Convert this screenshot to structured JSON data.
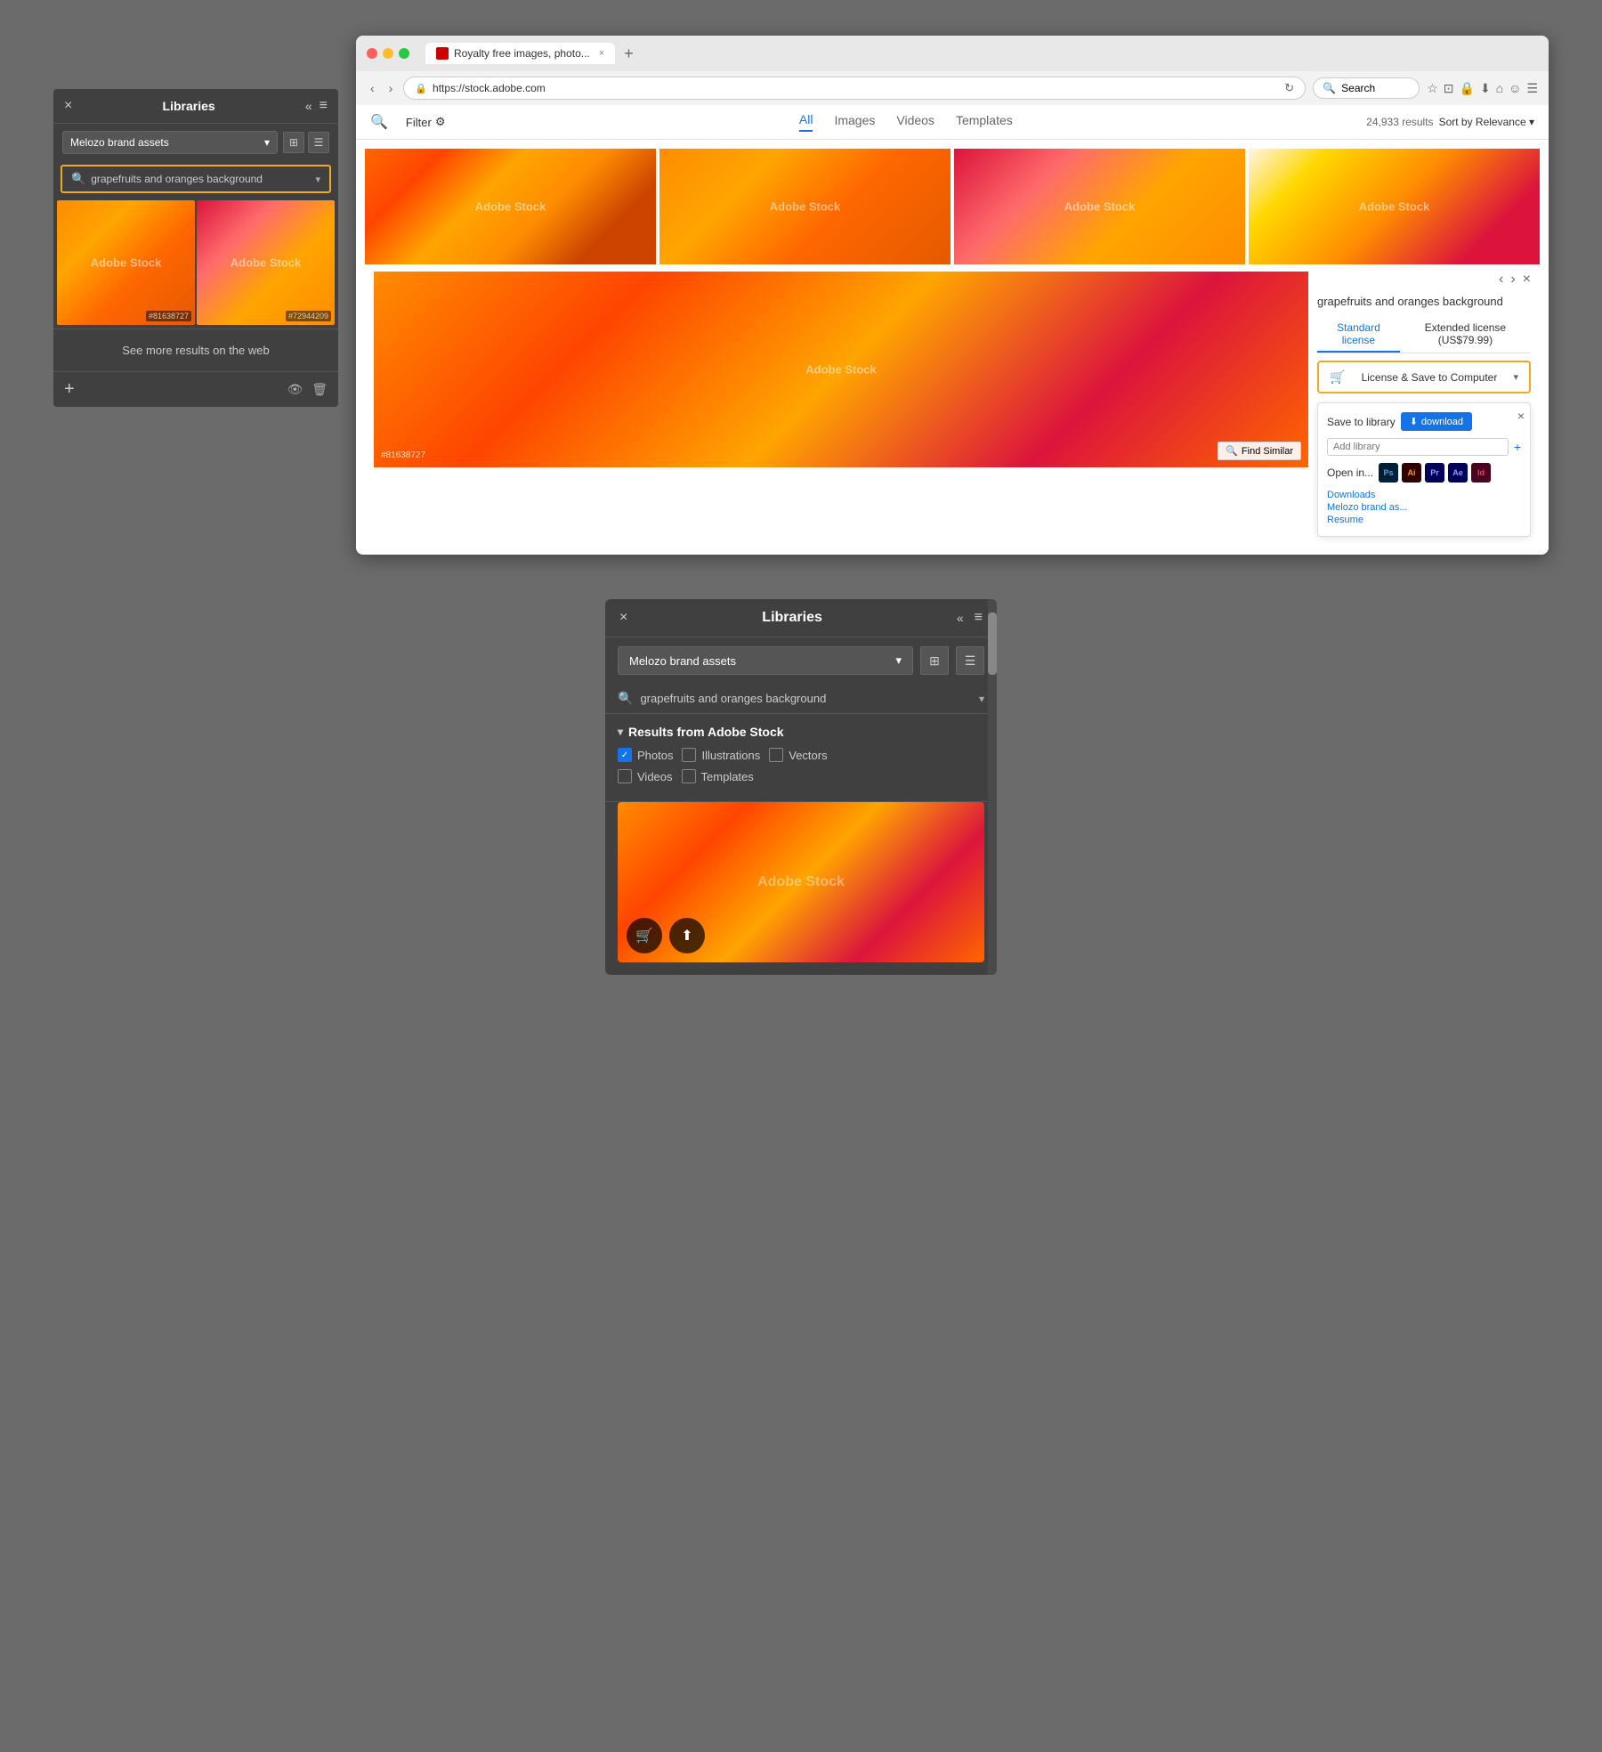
{
  "top_panel": {
    "close_label": "×",
    "collapse_label": "«",
    "title": "Libraries",
    "hamburger": "≡",
    "dropdown": {
      "selected": "Melozo brand assets",
      "chevron": "▾"
    },
    "view_grid": "⊞",
    "view_list": "☰",
    "search": {
      "icon": "🔍",
      "text": "grapefruits and oranges background",
      "chevron": "▾"
    },
    "image1": {
      "id": "#81638727"
    },
    "image2": {
      "id": "#72944209"
    },
    "see_more": "See more results on the web",
    "footer": {
      "add": "+",
      "eye": "👁",
      "trash": "🗑"
    }
  },
  "browser": {
    "tab_title": "Royalty free images, photo...",
    "url": "https://stock.adobe.com",
    "search_placeholder": "Search",
    "nav": {
      "back": "‹",
      "forward": "›",
      "refresh": "↻",
      "new_tab": "+"
    },
    "toolbar_icons": [
      "☆",
      "⊡",
      "🔒",
      "⬇",
      "⌂",
      "☺",
      "☰"
    ]
  },
  "stock": {
    "filter_btn": "Filter",
    "tabs": [
      "All",
      "Images",
      "Videos",
      "Templates"
    ],
    "active_tab": "All",
    "results_count": "24,933 results",
    "sort_label": "Sort by Relevance",
    "detail_title": "grapefruits and oranges background",
    "detail_id": "#81638727",
    "nav_prev": "‹",
    "nav_next": "›",
    "nav_close": "×",
    "license_tabs": [
      "Standard license",
      "Extended license (US$79.99)"
    ],
    "active_license": "Standard license",
    "license_btn": "License & Save to  Computer",
    "save_to_library": "Save to library",
    "download_btn": "download",
    "add_library_placeholder": "Add library",
    "open_in": "Open in...",
    "app_icons": [
      {
        "label": "Ps",
        "class": "app-ps"
      },
      {
        "label": "Ai",
        "class": "app-ai"
      },
      {
        "label": "Pr",
        "class": "app-pr"
      },
      {
        "label": "Ae",
        "class": "app-ae"
      },
      {
        "label": "Id",
        "class": "app-id"
      }
    ],
    "save_links": [
      "Downloads",
      "Melozo brand as...",
      "Resume"
    ],
    "find_similar": "Find Similar"
  },
  "bottom_panel": {
    "close_label": "×",
    "collapse_label": "«",
    "title": "Libraries",
    "hamburger": "≡",
    "dropdown": {
      "selected": "Melozo brand assets",
      "chevron": "▾"
    },
    "view_grid": "⊞",
    "view_list": "☰",
    "search": {
      "icon": "🔍",
      "text": "grapefruits and oranges background",
      "chevron": "▾"
    },
    "results_section": {
      "title": "Results from Adobe Stock",
      "chevron": "▾",
      "filters": [
        {
          "label": "Photos",
          "checked": true
        },
        {
          "label": "Illustrations",
          "checked": false
        },
        {
          "label": "Vectors",
          "checked": false
        },
        {
          "label": "Videos",
          "checked": false
        },
        {
          "label": "Templates",
          "checked": false
        }
      ]
    },
    "overlay_btn1": "🛒",
    "overlay_btn2": "⬆",
    "adobe_watermark": "Adobe Stock"
  }
}
